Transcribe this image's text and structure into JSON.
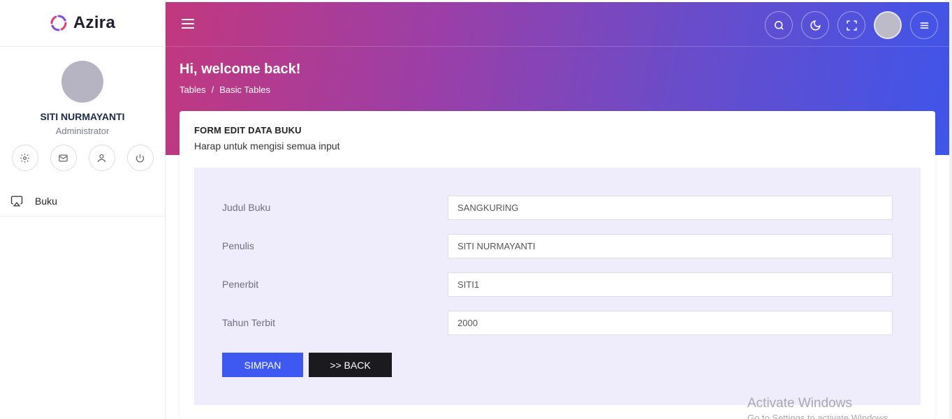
{
  "brand": {
    "name": "Azira"
  },
  "profile": {
    "name": "SITI NURMAYANTI",
    "role": "Administrator"
  },
  "sidebar": {
    "items": [
      {
        "label": "Buku",
        "icon": "airplay-icon"
      }
    ]
  },
  "header": {
    "greeting": "Hi, welcome back!",
    "breadcrumb": [
      "Tables",
      "/",
      "Basic Tables"
    ],
    "icons": [
      "search-icon",
      "moon-icon",
      "fullscreen-icon",
      "avatar",
      "menu-icon"
    ]
  },
  "form": {
    "title": "FORM EDIT DATA BUKU",
    "subtitle": "Harap untuk mengisi semua input",
    "fields": [
      {
        "label": "Judul Buku",
        "value": "SANGKURING"
      },
      {
        "label": "Penulis",
        "value": "SITI NURMAYANTI"
      },
      {
        "label": "Penerbit",
        "value": "SITI1"
      },
      {
        "label": "Tahun Terbit",
        "value": "2000"
      }
    ],
    "save_label": "SIMPAN",
    "back_label": ">> BACK"
  },
  "watermark": {
    "title": "Activate Windows",
    "subtitle": "Go to Settings to activate Windows."
  },
  "colors": {
    "gradient_start": "#c2387e",
    "gradient_end": "#3f55ea",
    "primary": "#3e59f2",
    "dark": "#1b1b1f",
    "form_bg": "#efedfc"
  }
}
